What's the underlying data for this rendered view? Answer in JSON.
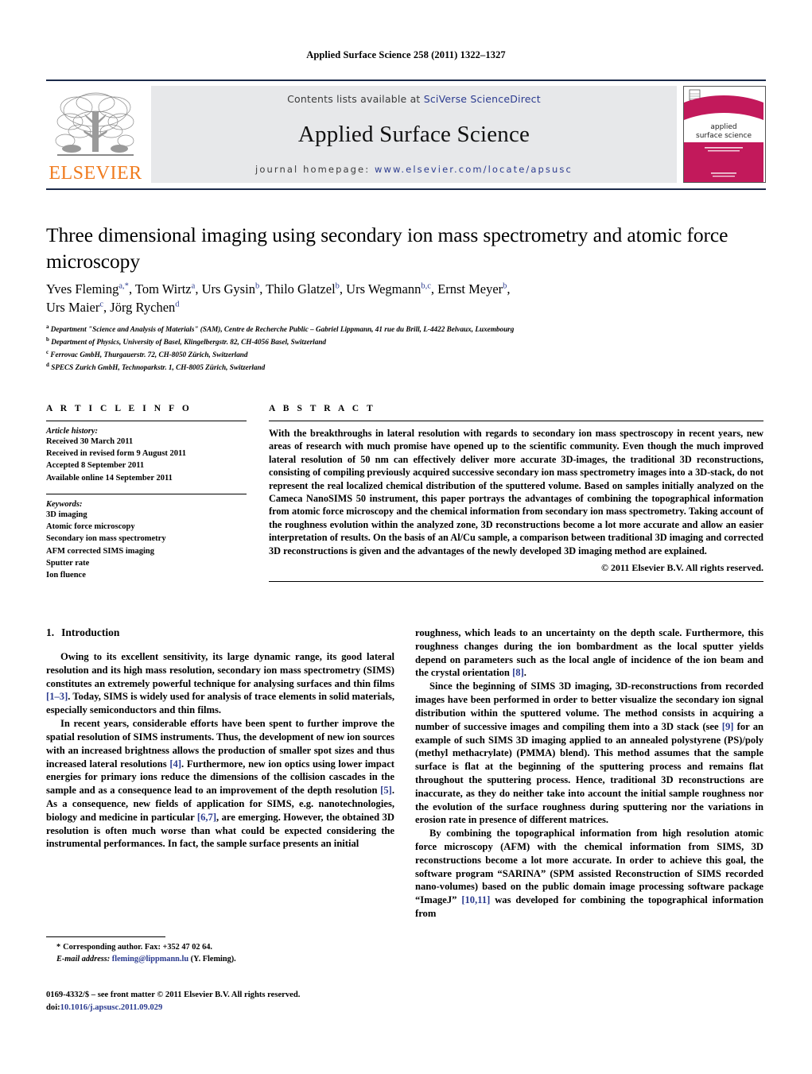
{
  "running_head": "Applied Surface Science 258 (2011) 1322–1327",
  "masthead": {
    "publisher_name": "ELSEVIER",
    "contents_prefix": "Contents lists available at ",
    "contents_link": "SciVerse ScienceDirect",
    "journal_title": "Applied Surface Science",
    "homepage_label": "journal  homepage:  ",
    "homepage_url": "www.elsevier.com/locate/apsusc",
    "cover": {
      "title_line1": "applied",
      "title_line2": "surface science",
      "subtitle": "a journal devoted to applied physics and chemistry of surfaces and interfaces",
      "footer": "ELSEVIER",
      "accent_color": "#C2195B"
    }
  },
  "article": {
    "title": "Three dimensional imaging using secondary ion mass spectrometry and atomic force microscopy",
    "authors_line1": [
      {
        "name": "Yves Fleming",
        "sup": "a,*"
      },
      {
        "name": "Tom Wirtz",
        "sup": "a"
      },
      {
        "name": "Urs Gysin",
        "sup": "b"
      },
      {
        "name": "Thilo Glatzel",
        "sup": "b"
      },
      {
        "name": "Urs Wegmann",
        "sup": "b,c"
      },
      {
        "name": "Ernst Meyer",
        "sup": "b"
      }
    ],
    "authors_line2": [
      {
        "name": "Urs Maier",
        "sup": "c"
      },
      {
        "name": "Jörg Rychen",
        "sup": "d"
      }
    ],
    "affiliations": [
      {
        "sup": "a",
        "text": "Department \"Science and Analysis of Materials\" (SAM), Centre de Recherche Public – Gabriel Lippmann, 41 rue du Brill, L-4422 Belvaux, Luxembourg"
      },
      {
        "sup": "b",
        "text": "Department of Physics, University of Basel, Klingelbergstr. 82, CH-4056 Basel, Switzerland"
      },
      {
        "sup": "c",
        "text": "Ferrovac GmbH, Thurgauerstr. 72, CH-8050 Zürich, Switzerland"
      },
      {
        "sup": "d",
        "text": "SPECS Zurich GmbH, Technoparkstr. 1, CH-8005 Zürich, Switzerland"
      }
    ]
  },
  "article_info": {
    "heading": "A R T I C L E    I N F O",
    "history_label": "Article history:",
    "history": [
      "Received 30 March 2011",
      "Received in revised form 9 August 2011",
      "Accepted 8 September 2011",
      "Available online 14 September 2011"
    ],
    "keywords_label": "Keywords:",
    "keywords": [
      "3D imaging",
      "Atomic force microscopy",
      "Secondary ion mass spectrometry",
      "AFM corrected SIMS imaging",
      "Sputter rate",
      "Ion fluence"
    ]
  },
  "abstract": {
    "heading": "A B S T R A C T",
    "text": "With the breakthroughs in lateral resolution with regards to secondary ion mass spectroscopy in recent years, new areas of research with much promise have opened up to the scientific community. Even though the much improved lateral resolution of 50 nm can effectively deliver more accurate 3D-images, the traditional 3D reconstructions, consisting of compiling previously acquired successive secondary ion mass spectrometry images into a 3D-stack, do not represent the real localized chemical distribution of the sputtered volume. Based on samples initially analyzed on the Cameca NanoSIMS 50 instrument, this paper portrays the advantages of combining the topographical information from atomic force microscopy and the chemical information from secondary ion mass spectrometry. Taking account of the roughness evolution within the analyzed zone, 3D reconstructions become a lot more accurate and allow an easier interpretation of results. On the basis of an Al/Cu sample, a comparison between traditional 3D imaging and corrected 3D reconstructions is given and the advantages of the newly developed 3D imaging method are explained.",
    "copyright": "© 2011 Elsevier B.V. All rights reserved."
  },
  "body": {
    "section_number": "1.",
    "section_title": "Introduction",
    "left_paragraphs": [
      {
        "parts": [
          {
            "t": "Owing to its excellent sensitivity, its large dynamic range, its good lateral resolution and its high mass resolution, secondary ion mass spectrometry (SIMS) constitutes an extremely powerful technique for analysing surfaces and thin films ",
            "ref": false
          },
          {
            "t": "[1–3]",
            "ref": true
          },
          {
            "t": ". Today, SIMS is widely used for analysis of trace elements in solid materials, especially semiconductors and thin films.",
            "ref": false
          }
        ]
      },
      {
        "parts": [
          {
            "t": "In recent years, considerable efforts have been spent to further improve the spatial resolution of SIMS instruments. Thus, the development of new ion sources with an increased brightness allows the production of smaller spot sizes and thus increased lateral resolutions ",
            "ref": false
          },
          {
            "t": "[4]",
            "ref": true
          },
          {
            "t": ". Furthermore, new ion optics using lower impact energies for primary ions reduce the dimensions of the collision cascades in the sample and as a consequence lead to an improvement of the depth resolution ",
            "ref": false
          },
          {
            "t": "[5]",
            "ref": true
          },
          {
            "t": ". As a consequence, new fields of application for SIMS, e.g. nanotechnologies, biology and medicine in particular ",
            "ref": false
          },
          {
            "t": "[6,7]",
            "ref": true
          },
          {
            "t": ", are emerging. However, the obtained 3D resolution is often much worse than what could be expected considering the instrumental performances. In fact, the sample surface presents an initial",
            "ref": false
          }
        ]
      }
    ],
    "right_paragraphs": [
      {
        "noindent": true,
        "parts": [
          {
            "t": "roughness, which leads to an uncertainty on the depth scale. Furthermore, this roughness changes during the ion bombardment as the local sputter yields depend on parameters such as the local angle of incidence of the ion beam and the crystal orientation ",
            "ref": false
          },
          {
            "t": "[8]",
            "ref": true
          },
          {
            "t": ".",
            "ref": false
          }
        ]
      },
      {
        "noindent": false,
        "parts": [
          {
            "t": "Since the beginning of SIMS 3D imaging, 3D-reconstructions from recorded images have been performed in order to better visualize the secondary ion signal distribution within the sputtered volume. The method consists in acquiring a number of successive images and compiling them into a 3D stack (see ",
            "ref": false
          },
          {
            "t": "[9]",
            "ref": true
          },
          {
            "t": " for an example of such SIMS 3D imaging applied to an annealed polystyrene (PS)/poly (methyl methacrylate) (PMMA) blend). This method assumes that the sample surface is flat at the beginning of the sputtering process and remains flat throughout the sputtering process. Hence, traditional 3D reconstructions are inaccurate, as they do neither take into account the initial sample roughness nor the evolution of the surface roughness during sputtering nor the variations in erosion rate in presence of different matrices.",
            "ref": false
          }
        ]
      },
      {
        "noindent": false,
        "parts": [
          {
            "t": "By combining the topographical information from high resolution atomic force microscopy (AFM) with the chemical information from SIMS, 3D reconstructions become a lot more accurate. In order to achieve this goal, the software program “SARINA” (SPM assisted Reconstruction of SIMS recorded nano-volumes) based on the public domain image processing software package “ImageJ” ",
            "ref": false
          },
          {
            "t": "[10,11]",
            "ref": true
          },
          {
            "t": " was developed for combining the topographical information from",
            "ref": false
          }
        ]
      }
    ]
  },
  "footnotes": {
    "corresponding": "Corresponding author. Fax: +352 47 02 64.",
    "email_label": "E-mail address:",
    "email": "fleming@lippmann.lu",
    "email_suffix": "(Y. Fleming).",
    "frontmatter": "0169-4332/$ – see front matter © 2011 Elsevier B.V. All rights reserved.",
    "doi_label": "doi:",
    "doi": "10.1016/j.apsusc.2011.09.029"
  }
}
